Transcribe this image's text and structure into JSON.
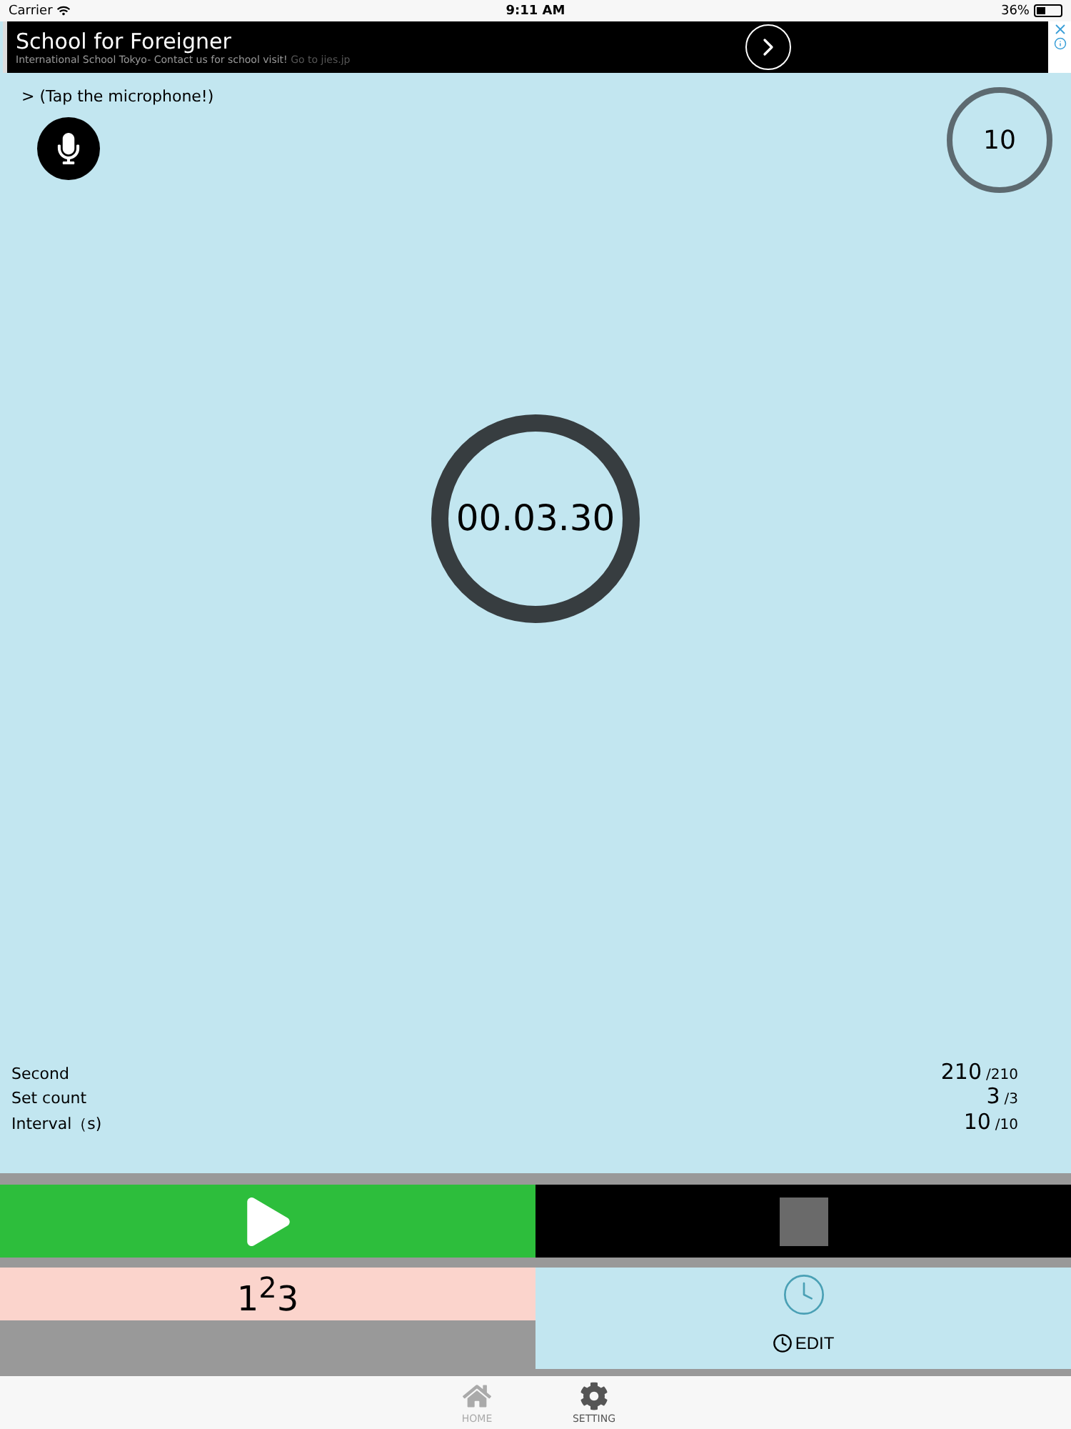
{
  "status_bar": {
    "carrier": "Carrier",
    "time": "9:11 AM",
    "battery": "36%"
  },
  "ad": {
    "title": "School for Foreigner",
    "text": "International School Tokyo- Contact us for school visit!",
    "link": "Go to jies.jp"
  },
  "hint": {
    "arrow": ">",
    "text": "(Tap the microphone!)"
  },
  "countdown": "10",
  "timer": "00.03.30",
  "stats": [
    {
      "label": "Second",
      "value": "210",
      "total": "/210"
    },
    {
      "label": "Set count",
      "value": "3",
      "total": "/3"
    },
    {
      "label": "Interval（s)",
      "value": "10",
      "total": "/10"
    }
  ],
  "controls": {
    "count_label": "1$^{2}$3",
    "edit_label": "EDIT"
  },
  "tabs": [
    {
      "label": "HOME",
      "disabled": true
    },
    {
      "label": "SETTING",
      "disabled": false
    }
  ]
}
